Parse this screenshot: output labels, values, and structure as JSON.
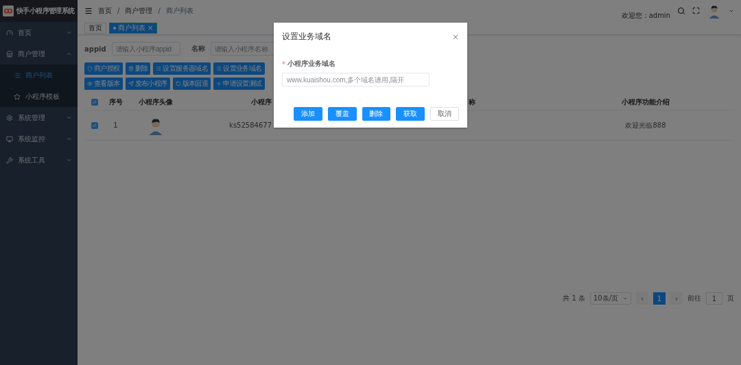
{
  "sidebar": {
    "app_title": "快手小程序管理系统",
    "items": [
      {
        "label": "首页",
        "expanded": false,
        "selected": false
      },
      {
        "label": "商户管理",
        "expanded": true,
        "selected": false,
        "children": [
          {
            "label": "商户列表",
            "selected": true
          },
          {
            "label": "小程序模板",
            "selected": false
          }
        ]
      },
      {
        "label": "系统管理",
        "expanded": false,
        "selected": false
      },
      {
        "label": "系统监控",
        "expanded": false,
        "selected": false
      },
      {
        "label": "系统工具",
        "expanded": false,
        "selected": false
      }
    ]
  },
  "header": {
    "breadcrumb": [
      "首页",
      "商户管理",
      "商户列表"
    ],
    "separator": "/",
    "welcome": "欢迎您：admin"
  },
  "tags": [
    {
      "label": "首页",
      "selected": false
    },
    {
      "label": "商户列表",
      "selected": true,
      "close": "×"
    }
  ],
  "search_form": [
    {
      "label": "appid",
      "placeholder": "请输入小程序appid"
    },
    {
      "label": "名称",
      "placeholder": "请输入小程序名称"
    }
  ],
  "toolbar_rows": [
    [
      "商户授权",
      "删除",
      "设置服务器域名",
      "设置业务域名"
    ],
    [
      "查看版本",
      "发布小程序",
      "版本回退",
      "申请设置测试"
    ]
  ],
  "table": {
    "columns": [
      "序号",
      "小程序头像",
      "小程序",
      "称",
      "小程序功能介绍"
    ],
    "all_checked": true,
    "rows": [
      {
        "checked": true,
        "index": "1",
        "appid": "ks52584677",
        "intro": "欢迎光临888"
      }
    ]
  },
  "pagination": {
    "total": "共 1 条",
    "page_size": "10条/页",
    "prev": "‹",
    "pages": [
      {
        "label": "1",
        "selected": true
      }
    ],
    "next": "›",
    "goto_label": "前往",
    "goto_value": "1",
    "goto_suffix": "页"
  },
  "dialog": {
    "title": "设置业务域名",
    "close": "×",
    "required_mark": "*",
    "field_label": "小程序业务域名",
    "placeholder": "www.kuaishou.com,多个域名请用,隔开",
    "buttons": [
      {
        "label": "添加",
        "kind": "primary"
      },
      {
        "label": "覆盖",
        "kind": "primary"
      },
      {
        "label": "删除",
        "kind": "primary"
      },
      {
        "label": "获取",
        "kind": "primary"
      },
      {
        "label": "取消",
        "kind": "plain"
      }
    ]
  }
}
